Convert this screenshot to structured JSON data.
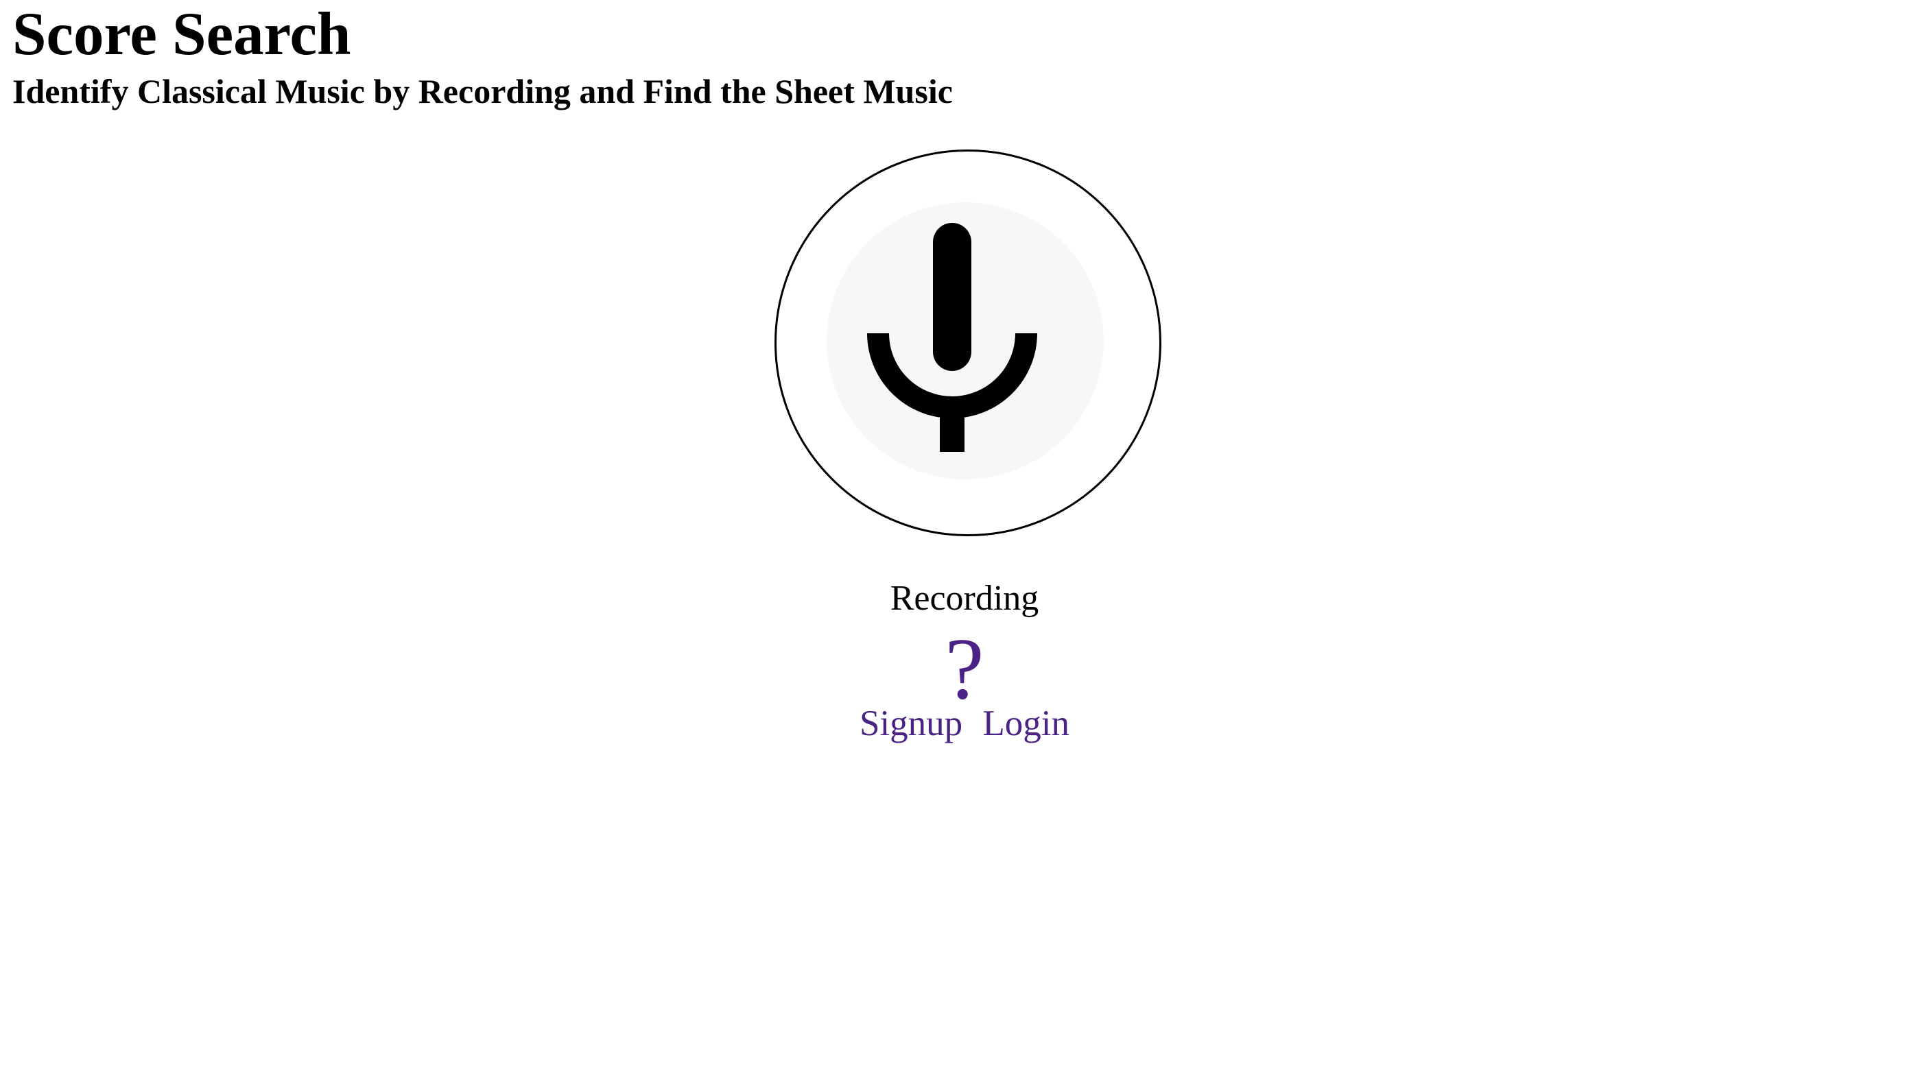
{
  "header": {
    "title": "Score Search",
    "subtitle": "Identify Classical Music by Recording and Find the Sheet Music"
  },
  "recorder": {
    "icon": "microphone-icon",
    "status_text": "Recording"
  },
  "help": {
    "label": "?",
    "icon": "question-mark-icon"
  },
  "auth": {
    "signup_label": "Signup",
    "login_label": "Login"
  },
  "colors": {
    "link": "#4b2387",
    "text": "#000000",
    "mic_background": "#f7f7f7",
    "page_background": "#ffffff"
  }
}
